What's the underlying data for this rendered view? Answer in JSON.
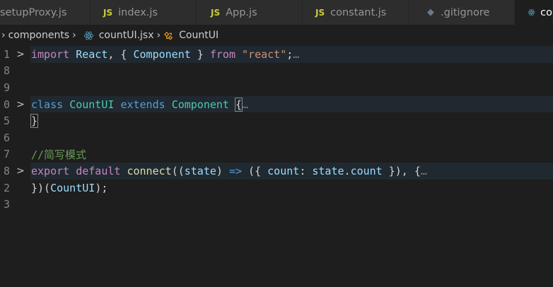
{
  "tabs": [
    {
      "label": "setupProxy.js",
      "icon": "js-icon",
      "icon_text": "",
      "active": false
    },
    {
      "label": "index.js",
      "icon": "js-icon",
      "icon_text": "JS",
      "active": false
    },
    {
      "label": "App.js",
      "icon": "js-icon",
      "icon_text": "JS",
      "active": false
    },
    {
      "label": "constant.js",
      "icon": "js-icon",
      "icon_text": "JS",
      "active": false
    },
    {
      "label": ".gitignore",
      "icon": "git-icon",
      "icon_text": "◆",
      "active": false
    },
    {
      "label": "co",
      "icon": "react-icon",
      "icon_text": "",
      "active": true
    }
  ],
  "breadcrumb": {
    "folder": "components",
    "file": "countUI.jsx",
    "symbol": "CountUI"
  },
  "editor": {
    "lines": [
      {
        "number": "1",
        "fold": ">",
        "segments": [
          [
            "kw",
            "import"
          ],
          [
            "pl",
            " "
          ],
          [
            "var",
            "React"
          ],
          [
            "pl",
            ", { "
          ],
          [
            "var",
            "Component"
          ],
          [
            "pl",
            " } "
          ],
          [
            "kw",
            "from"
          ],
          [
            "pl",
            " "
          ],
          [
            "str",
            "\"react\""
          ],
          [
            "pl",
            ";"
          ],
          [
            "ell",
            "…"
          ]
        ]
      },
      {
        "number": "8",
        "fold": "",
        "segments": []
      },
      {
        "number": "9",
        "fold": "",
        "segments": []
      },
      {
        "number": "0",
        "fold": ">",
        "segments": [
          [
            "kw2",
            "class"
          ],
          [
            "pl",
            " "
          ],
          [
            "cls",
            "CountUI"
          ],
          [
            "pl",
            " "
          ],
          [
            "kw2",
            "extends"
          ],
          [
            "pl",
            " "
          ],
          [
            "cls",
            "Component"
          ],
          [
            "pl",
            " "
          ],
          [
            "brace",
            "{"
          ],
          [
            "ell",
            "…"
          ]
        ]
      },
      {
        "number": "5",
        "fold": "",
        "segments": [
          [
            "brace2",
            "}"
          ]
        ]
      },
      {
        "number": "6",
        "fold": "",
        "segments": []
      },
      {
        "number": "7",
        "fold": "",
        "segments": [
          [
            "cmt",
            "//简写模式"
          ]
        ]
      },
      {
        "number": "8",
        "fold": ">",
        "segments": [
          [
            "kw",
            "export"
          ],
          [
            "pl",
            " "
          ],
          [
            "kw",
            "default"
          ],
          [
            "pl",
            " "
          ],
          [
            "fn",
            "connect"
          ],
          [
            "pl",
            "(("
          ],
          [
            "var",
            "state"
          ],
          [
            "pl",
            ") "
          ],
          [
            "kw2",
            "=>"
          ],
          [
            "pl",
            " ({ "
          ],
          [
            "var",
            "count"
          ],
          [
            "pl",
            ": "
          ],
          [
            "var",
            "state"
          ],
          [
            "pl",
            "."
          ],
          [
            "var",
            "count"
          ],
          [
            "pl",
            " }), {"
          ],
          [
            "ell",
            "…"
          ]
        ]
      },
      {
        "number": "2",
        "fold": "",
        "segments": [
          [
            "pl",
            "})("
          ],
          [
            "var",
            "CountUI"
          ],
          [
            "pl",
            ");"
          ]
        ]
      },
      {
        "number": "3",
        "fold": "",
        "segments": []
      }
    ]
  },
  "colors": {
    "editor_bg": "#1e1e1e",
    "tabbar_bg": "#252526",
    "keyword": "#c586c0",
    "storage": "#569cd6",
    "class": "#4ec9b0",
    "string": "#ce9178",
    "function": "#dcdcaa",
    "comment": "#6a9955"
  }
}
